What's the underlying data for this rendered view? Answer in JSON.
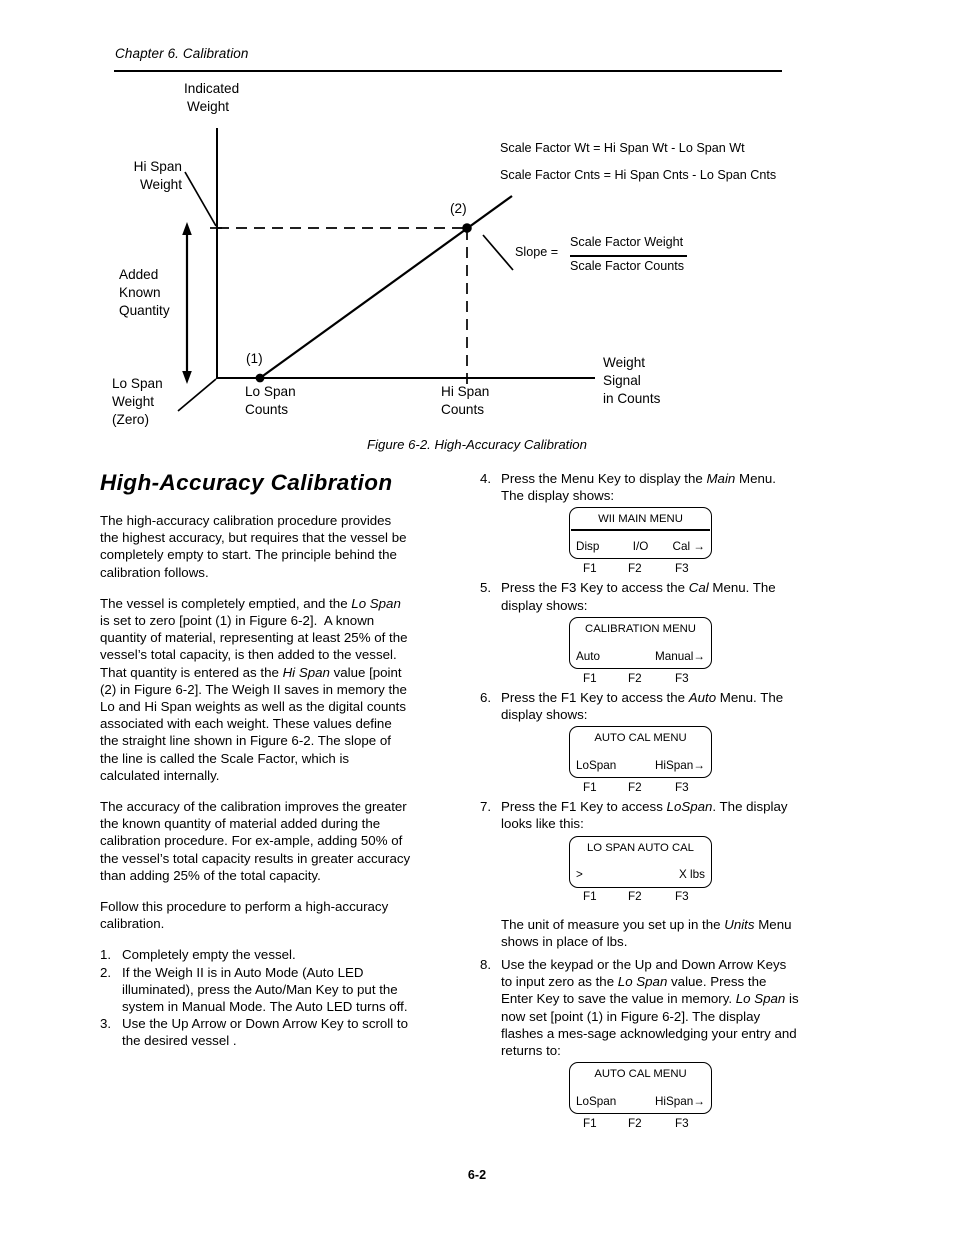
{
  "header": {
    "running_head": "Chapter 6. Calibration"
  },
  "figure": {
    "caption": "Figure 6-2. High-Accuracy Calibration",
    "labels": {
      "y_axis_title_line1": "Indicated",
      "y_axis_title_line2": "Weight",
      "hi_span_weight_line1": "Hi Span",
      "hi_span_weight_line2": "Weight",
      "added_known_line1": "Added",
      "added_known_line2": "Known",
      "added_known_line3": "Quantity",
      "lo_span_weight_line1": "Lo Span",
      "lo_span_weight_line2": "Weight",
      "lo_span_weight_line3": "(Zero)",
      "point_1": "(1)",
      "point_2": "(2)",
      "lo_span_counts_line1": "Lo Span",
      "lo_span_counts_line2": "Counts",
      "hi_span_counts_line1": "Hi Span",
      "hi_span_counts_line2": "Counts",
      "x_axis_title_line1": "Weight",
      "x_axis_title_line2": "Signal",
      "x_axis_title_line3": "in Counts",
      "formula_1": "Scale Factor Wt = Hi Span Wt - Lo Span Wt",
      "formula_2": "Scale Factor Cnts = Hi Span Cnts - Lo Span Cnts",
      "slope_label": "Slope =",
      "slope_numerator": "Scale Factor Weight",
      "slope_denominator": "Scale Factor Counts"
    }
  },
  "left_column": {
    "heading": "High-Accuracy  Calibration",
    "paragraphs": [
      "The high-accuracy calibration procedure provides the highest accuracy, but requires that the vessel be completely empty to start. The principle behind the calibration follows.",
      "The accuracy of the calibration improves the greater the known quantity of material added during the calibration procedure. For ex-ample, adding 50% of the vessel’s total capacity results in greater accuracy than adding 25% of the total capacity.",
      "Follow this procedure to perform a high-accuracy calibration."
    ],
    "steps": [
      {
        "num": "1.",
        "text": "Completely empty the vessel."
      },
      {
        "num": "2.",
        "text": "If the Weigh II is in Auto Mode (Auto LED illuminated), press the Auto/Man Key to put the system in Manual Mode. The Auto LED turns off."
      },
      {
        "num": "3.",
        "text": "Use the Up Arrow or Down Arrow Key to scroll to the desired vessel ."
      }
    ]
  },
  "right_column": {
    "steps": [
      {
        "num": "4.",
        "text_before": "Press the Menu Key to display the ",
        "emphasis": "Main",
        "text_after": " Menu. The display shows:"
      },
      {
        "num": "5.",
        "text_before": "Press the F3 Key to access the ",
        "emphasis": "Cal",
        "text_after": " Menu. The display shows:"
      },
      {
        "num": "6.",
        "text_before": "Press the F1 Key to access the ",
        "emphasis": "Auto",
        "text_after": " Menu. The display shows:"
      },
      {
        "num": "7.",
        "text_before": "Press the F1 Key to access ",
        "emphasis": "LoSpan",
        "text_after": ". The display looks like this:"
      },
      {
        "num": "8.",
        "text_before": "Use the keypad or the Up and Down Arrow Keys to input zero as the ",
        "emphasis": "Lo Span",
        "text_after": " value. Press the Enter Key to save the value in memory. "
      }
    ],
    "note_units_before": "The unit of measure you set up in the ",
    "note_units_emphasis": "Units",
    "note_units_after": " Menu shows in place of lbs.",
    "step8_tail_emphasis": "Lo Span",
    "step8_tail": " is now set [point (1) in Figure 6-2]. The display flashes a mes-sage acknowledging your entry and returns to:",
    "displays": [
      {
        "title": "WII MAIN MENU",
        "has_rule": true,
        "left": "Disp",
        "center": "I/O",
        "right": "Cal →",
        "fkeys": [
          "F1",
          "F2",
          "F3"
        ]
      },
      {
        "title": "CALIBRATION  MENU",
        "has_rule": false,
        "left": "Auto",
        "center": "",
        "right": "Manual→",
        "fkeys": [
          "F1",
          "F2",
          "F3"
        ]
      },
      {
        "title": "AUTO CAL MENU",
        "has_rule": false,
        "left": "LoSpan",
        "center": "",
        "right": "HiSpan→",
        "fkeys": [
          "F1",
          "F2",
          "F3"
        ]
      },
      {
        "title": "LO SPAN AUTO CAL",
        "has_rule": false,
        "left": ">",
        "center": "",
        "right": "X   lbs",
        "fkeys": [
          "F1",
          "F2",
          "F3"
        ]
      },
      {
        "title": "AUTO CAL MENU",
        "has_rule": false,
        "left": "LoSpan",
        "center": "",
        "right": "HiSpan→",
        "fkeys": [
          "F1",
          "F2",
          "F3"
        ]
      }
    ]
  },
  "footer": {
    "page_number": "6-2"
  },
  "chart_data": {
    "type": "line",
    "title": "Figure 6-2. High-Accuracy Calibration",
    "xlabel": "Weight Signal in Counts",
    "ylabel": "Indicated Weight",
    "series": [
      {
        "name": "Calibration line",
        "points": [
          {
            "label": "(1)",
            "x": "Lo Span Counts",
            "y": "Lo Span Weight (Zero)"
          },
          {
            "label": "(2)",
            "x": "Hi Span Counts",
            "y": "Hi Span Weight"
          }
        ]
      }
    ],
    "annotations": [
      "Added Known Quantity",
      "Scale Factor Wt = Hi Span Wt - Lo Span Wt",
      "Scale Factor Cnts = Hi Span Cnts - Lo Span Cnts",
      "Slope = Scale Factor Weight / Scale Factor Counts"
    ],
    "grid": false,
    "legend": "none"
  }
}
